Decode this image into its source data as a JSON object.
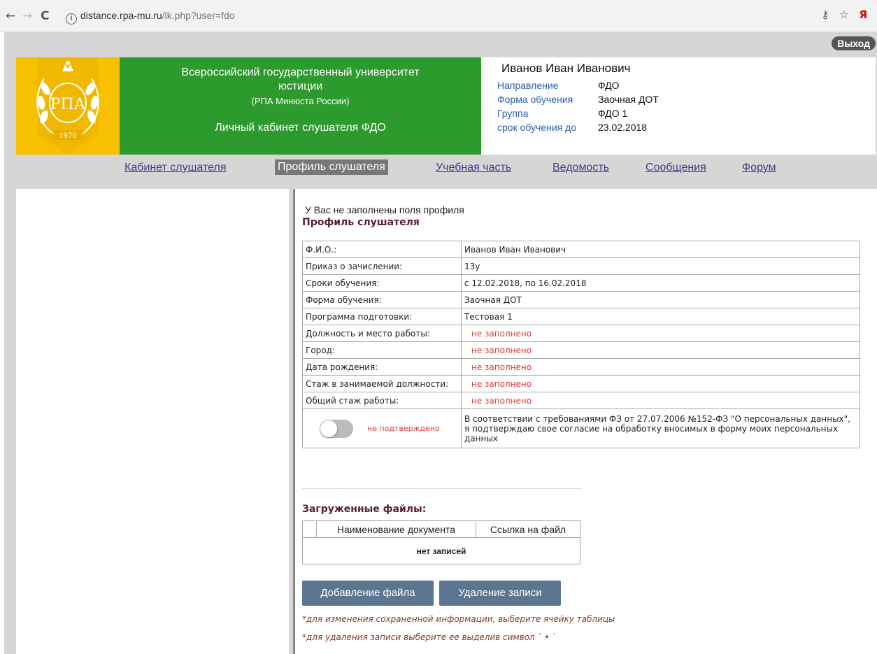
{
  "browser": {
    "back": "←",
    "forward": "→",
    "reload": "C",
    "url_host": "distance.rpa-mu.ru",
    "url_path": "/lk.php?user=fdo",
    "key_icon": "key-icon",
    "star_icon": "star-icon",
    "yandex_label": "Я"
  },
  "header": {
    "logout": "Выход",
    "logo_year": "1970",
    "logo_text": "РПА",
    "univ_line1": "Всероссийский государственный университет",
    "univ_line2": "юстиции",
    "univ_line3": "(РПА Минюста России)",
    "cabinet": "Личный кабинет слушателя ФДО",
    "user_name": "Иванов Иван Иванович",
    "info": [
      {
        "key": "Направление",
        "value": "ФДО"
      },
      {
        "key": "Форма обучения",
        "value": "Заочная ДОТ"
      },
      {
        "key": "Группа",
        "value": "ФДО 1"
      },
      {
        "key": "срок обучения до",
        "value": "23.02.2018"
      }
    ]
  },
  "menu": [
    {
      "label": "Кабинет слушателя"
    },
    {
      "label": "Профиль слушателя"
    },
    {
      "label": "Учебная часть"
    },
    {
      "label": "Ведомость"
    },
    {
      "label": "Сообщения"
    },
    {
      "label": "Форум"
    }
  ],
  "profile": {
    "message": "У Вас не заполнены поля профиля",
    "title": "Профиль слушателя",
    "rows": [
      {
        "label": "Ф.И.О.:",
        "value": "Иванов Иван Иванович"
      },
      {
        "label": "Приказ о зачислении:",
        "value": "13у"
      },
      {
        "label": "Сроки обучения:",
        "value": "с 12.02.2018, по 16.02.2018"
      },
      {
        "label": "Форма обучения:",
        "value": "Заочная ДОТ"
      },
      {
        "label": "Программа подготовки:",
        "value": "Тестовая 1"
      },
      {
        "label": "Должность и место работы:",
        "value": "не заполнено"
      },
      {
        "label": "Город:",
        "value": "не заполнено"
      },
      {
        "label": "Дата рождения:",
        "value": "не заполнено"
      },
      {
        "label": "Стаж в занимаемой должности:",
        "value": "не заполнено"
      },
      {
        "label": "Общий стаж работы:",
        "value": "не заполнено"
      }
    ],
    "consent_status": "не подтверждено",
    "consent_text": "В соответствии с требованиями ФЗ от 27.07.2006 №152-ФЗ \"О персональных данных\", я подтверждаю свое согласие на обработку вносимых в форму моих персональных данных"
  },
  "files": {
    "title": "Загруженные файлы:",
    "col_name": "Наименование документа",
    "col_link": "Ссылка на файл",
    "empty": "нет записей",
    "add_button": "Добавление файла",
    "delete_button": "Удаление записи",
    "note1": "*для изменения сохраненной информации, выберите ячейку таблицы",
    "note2": "*для удаления записи выберите ее выделив символ ` • `"
  }
}
